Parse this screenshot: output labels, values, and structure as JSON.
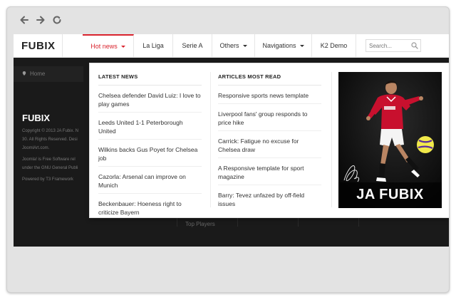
{
  "browser": {
    "back_icon": "arrow-left-icon",
    "forward_icon": "arrow-right-icon",
    "reload_icon": "reload-icon"
  },
  "site": {
    "logo": "FUBIX",
    "accent_color": "#d9232d",
    "menu": [
      {
        "label": "Hot news",
        "has_caret": true,
        "active": true
      },
      {
        "label": "La Liga",
        "has_caret": false,
        "active": false
      },
      {
        "label": "Serie A",
        "has_caret": false,
        "active": false
      },
      {
        "label": "Others",
        "has_caret": true,
        "active": false
      },
      {
        "label": "Navigations",
        "has_caret": true,
        "active": false
      },
      {
        "label": "K2 Demo",
        "has_caret": false,
        "active": false
      }
    ],
    "search_placeholder": "Search..."
  },
  "background_page": {
    "breadcrumb": "Home",
    "footer_logo": "FUBIX",
    "footer_lines": [
      "Copyright © 2013 JA Fubix. N",
      "30. All Rights Reserved. Desi",
      "JoomlArt.com.",
      "Joomla! is Free Software rel",
      "under the GNU General Publi",
      "Powered by T3 Framework"
    ],
    "top_players": "Top Players"
  },
  "dropdown": {
    "latest_news": {
      "title": "LATEST NEWS",
      "items": [
        "Chelsea defender David Luiz: I love to play games",
        "Leeds United 1-1 Peterborough United",
        "Wilkins backs Gus Poyet for Chelsea job",
        "Cazorla: Arsenal can improve on Munich",
        "Beckenbauer: Hoeness right to criticize Bayern"
      ]
    },
    "most_read": {
      "title": "ARTICLES MOST READ",
      "items": [
        "Responsive sports news template",
        "Liverpool fans' group responds to price hike",
        "Carrick: Fatigue no excuse for Chelsea draw",
        "A Responsive template for sport magazine",
        "Barry: Tevez unfazed by off-field issues"
      ]
    },
    "promo": {
      "caption": "JA FUBIX",
      "jersey_color": "#c8102e"
    }
  }
}
